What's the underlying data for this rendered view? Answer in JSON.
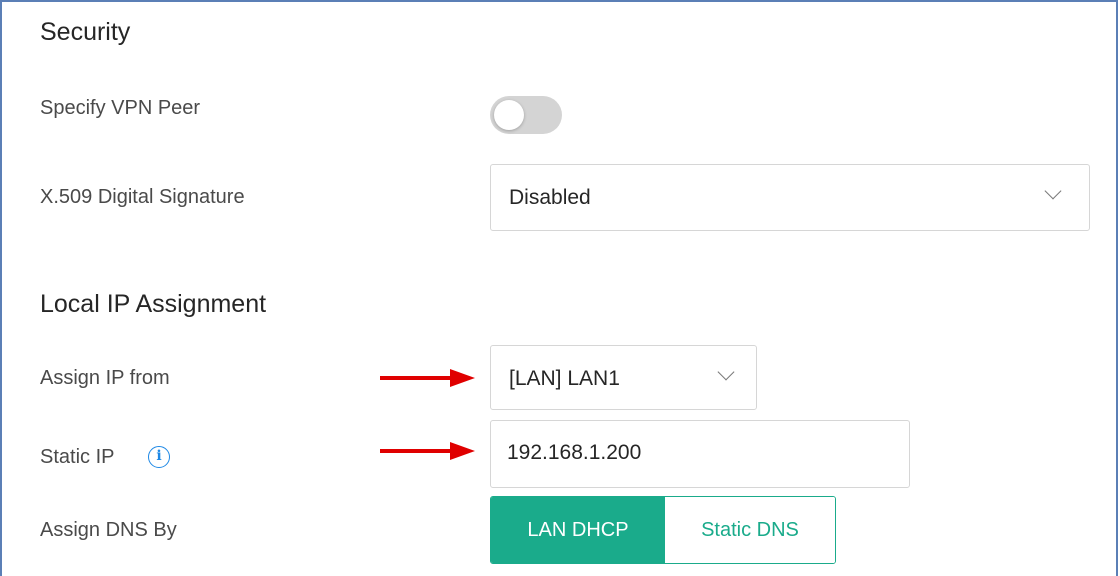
{
  "security": {
    "title": "Security",
    "vpn_peer_label": "Specify VPN Peer",
    "vpn_peer_enabled": false,
    "x509_label": "X.509 Digital Signature",
    "x509_value": "Disabled"
  },
  "local_ip": {
    "title": "Local IP Assignment",
    "assign_ip_label": "Assign IP from",
    "assign_ip_value": "[LAN] LAN1",
    "static_ip_label": "Static IP",
    "static_ip_value": "192.168.1.200",
    "dns_label": "Assign DNS By",
    "dns_options": [
      "LAN DHCP",
      "Static DNS"
    ],
    "dns_selected": "LAN DHCP"
  },
  "colors": {
    "accent": "#1aab8b",
    "arrow": "#e00000",
    "info": "#1e88e5",
    "frame_border": "#5b7fb6"
  },
  "icons": {
    "chevron": "chevron-down-icon",
    "info": "info-icon",
    "annotation": "red-arrow-icon"
  }
}
